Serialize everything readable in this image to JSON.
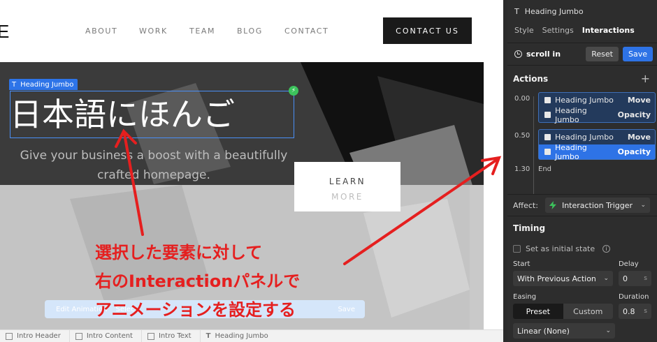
{
  "site": {
    "logo_glyph": "E",
    "nav": [
      "ABOUT",
      "WORK",
      "TEAM",
      "BLOG",
      "CONTACT"
    ],
    "cta": "CONTACT US",
    "heading": "日本語にほんご",
    "selection_tag": "Heading Jumbo",
    "subtitle": "Give your business a boost with a beautifully crafted homepage.",
    "learn_line1": "LEARN",
    "learn_line2": "MORE"
  },
  "edit_toolbar": {
    "edit_animation": "Edit Animation",
    "select": "Select",
    "save": "Save"
  },
  "breadcrumb": [
    "Intro Header",
    "Intro Content",
    "Intro Text",
    "Heading Jumbo"
  ],
  "panel": {
    "element_title": "Heading Jumbo",
    "tabs": [
      "Style",
      "Settings",
      "Interactions"
    ],
    "active_tab": "Interactions",
    "trigger": "scroll in",
    "reset": "Reset",
    "save": "Save",
    "actions_title": "Actions",
    "timeline": [
      {
        "time": "0.00",
        "rows": [
          {
            "name": "Heading Jumbo",
            "action": "Move",
            "selected": false
          },
          {
            "name": "Heading Jumbo",
            "action": "Opacity",
            "selected": false
          }
        ]
      },
      {
        "time": "0.50",
        "rows": [
          {
            "name": "Heading Jumbo",
            "action": "Move",
            "selected": false
          },
          {
            "name": "Heading Jumbo",
            "action": "Opacity",
            "selected": true
          }
        ]
      }
    ],
    "end_time": "1.30",
    "end_label": "End",
    "affect_label": "Affect:",
    "affect_value": "Interaction Trigger",
    "timing_title": "Timing",
    "initial_state": "Set as initial state",
    "start_label": "Start",
    "start_value": "With Previous Action",
    "delay_label": "Delay",
    "delay_value": "0",
    "delay_unit": "s",
    "easing_label": "Easing",
    "preset": "Preset",
    "custom": "Custom",
    "duration_label": "Duration",
    "duration_value": "0.8",
    "duration_unit": "s",
    "easing_value": "Linear (None)"
  },
  "annotation": {
    "line1": "選択した要素に対して",
    "line2": "右のInteractionパネルで",
    "line3": "アニメーションを設定する"
  },
  "colors": {
    "accent_blue": "#2e73e6",
    "annotation_red": "#e51f1f",
    "trigger_green": "#3cc35c"
  }
}
